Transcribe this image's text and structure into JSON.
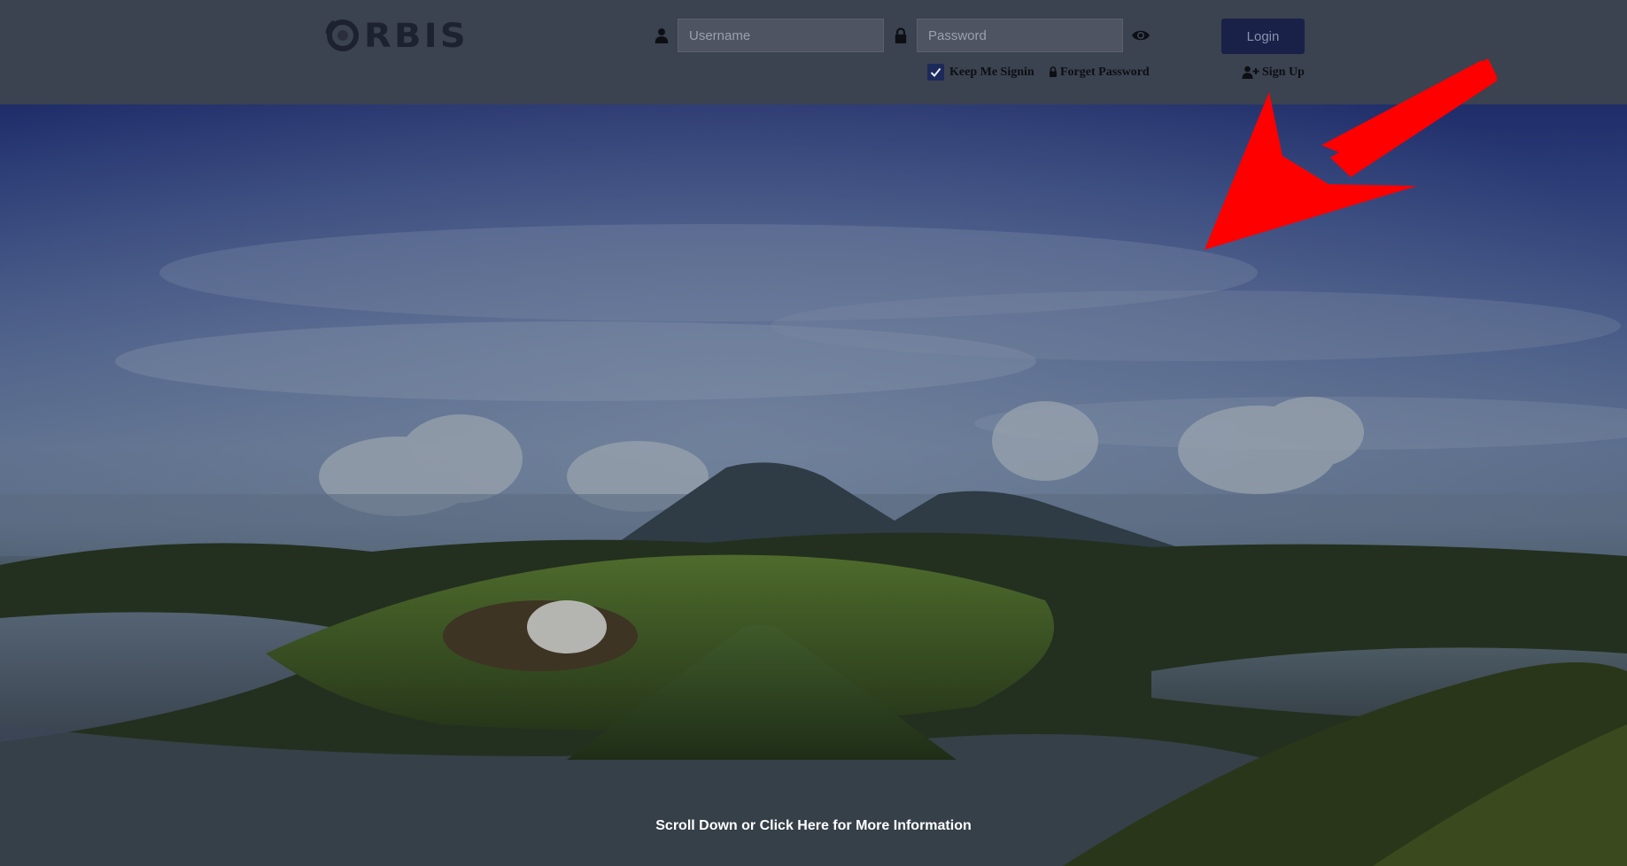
{
  "header": {
    "logo_text": "RBIS",
    "username": {
      "placeholder": "Username",
      "value": ""
    },
    "password": {
      "placeholder": "Password",
      "value": ""
    },
    "login_label": "Login",
    "keep_me_signin_label": "Keep Me Signin",
    "keep_me_signin_checked": true,
    "forget_password_label": "Forget Password",
    "sign_up_label": "Sign Up"
  },
  "hero": {
    "scroll_link_label": "Scroll Down or Click Here for More Information"
  },
  "icons": {
    "user": "user-icon",
    "lock": "lock-icon",
    "eye": "eye-icon",
    "check": "check-icon",
    "user_plus": "user-plus-icon"
  },
  "colors": {
    "header_bg": "#3b4250",
    "login_button": "#1a2148",
    "annotation_arrow": "#ff0000"
  }
}
